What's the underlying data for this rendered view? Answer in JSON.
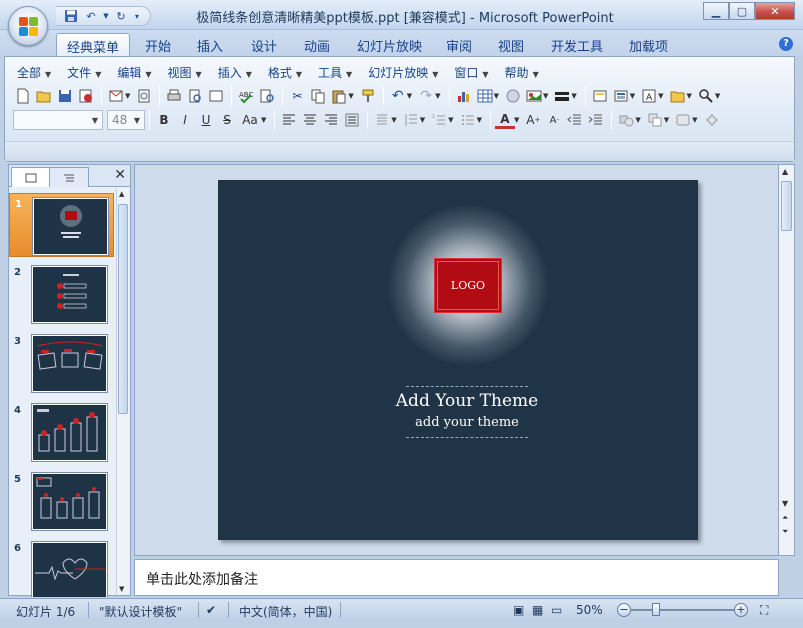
{
  "window": {
    "title": "极简线条创意清晰精美ppt模板.ppt [兼容模式] - Microsoft PowerPoint",
    "controls": [
      "minimize",
      "maximize",
      "close"
    ]
  },
  "qat": {
    "icons": [
      "save-icon",
      "undo-icon",
      "redo-icon",
      "customize-icon"
    ]
  },
  "ribbon": {
    "tabs": [
      "经典菜单",
      "开始",
      "插入",
      "设计",
      "动画",
      "幻灯片放映",
      "审阅",
      "视图",
      "开发工具",
      "加载项"
    ],
    "active_tab": "经典菜单",
    "menus": [
      "全部",
      "文件",
      "编辑",
      "视图",
      "插入",
      "格式",
      "工具",
      "幻灯片放映",
      "窗口",
      "帮助"
    ],
    "font_size_value": "48"
  },
  "slides_panel": {
    "numbers": [
      "1",
      "2",
      "3",
      "4",
      "5",
      "6"
    ],
    "selected": 1
  },
  "slide": {
    "logo_text": "LOGO",
    "title": "Add Your Theme",
    "subtitle": "add your theme"
  },
  "notes": {
    "placeholder": "单击此处添加备注"
  },
  "status": {
    "slide_indicator": "幻灯片 1/6",
    "theme": "\"默认设计模板\"",
    "language": "中文(简体，中国)",
    "zoom": "50%"
  },
  "colors": {
    "slide_background": "#1f3447",
    "logo_red": "#b10c14",
    "selection_orange": "#f0a040"
  }
}
